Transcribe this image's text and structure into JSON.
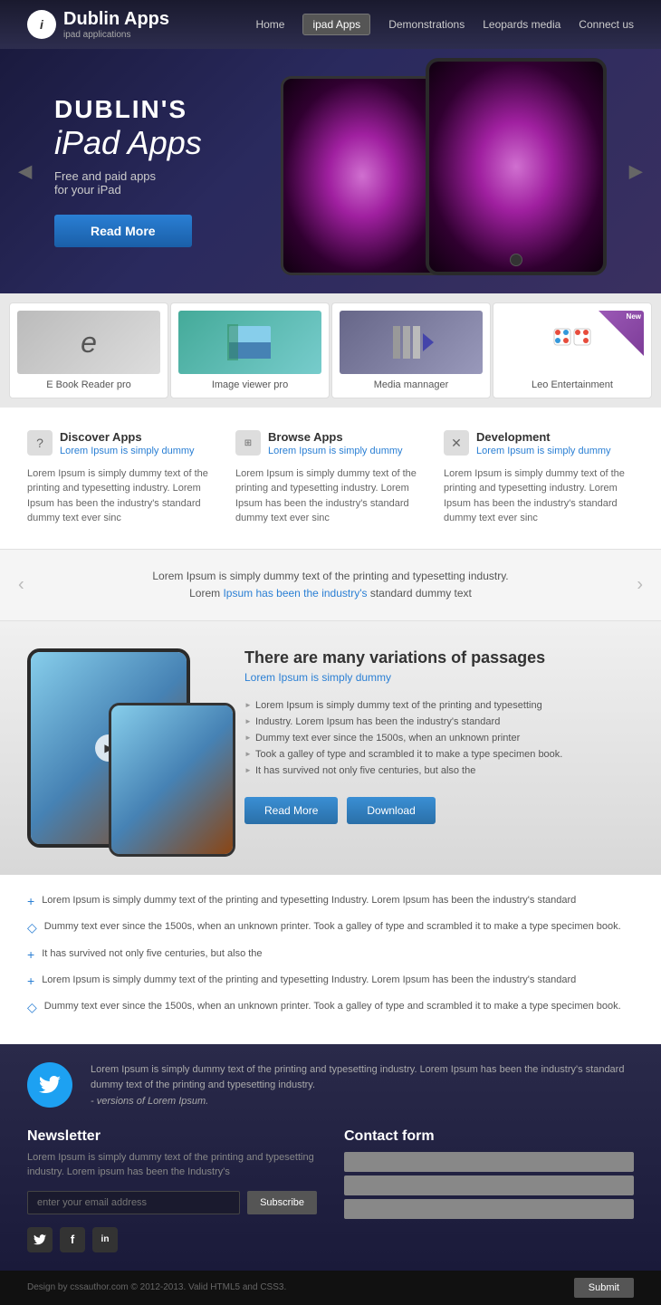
{
  "header": {
    "logo_icon": "i",
    "logo_name": "Dublin Apps",
    "logo_sub": "ipad applications",
    "nav": [
      {
        "label": "Home",
        "active": false
      },
      {
        "label": "ipad Apps",
        "active": true
      },
      {
        "label": "Demonstrations",
        "active": false
      },
      {
        "label": "Leopards media",
        "active": false
      },
      {
        "label": "Connect us",
        "active": false
      }
    ]
  },
  "hero": {
    "line1": "DUBLIN'S",
    "line2": "iPad Apps",
    "desc": "Free and paid apps\nfor your iPad",
    "cta": "Read More"
  },
  "apps": [
    {
      "name": "E Book Reader pro",
      "type": "ebook"
    },
    {
      "name": "Image viewer pro",
      "type": "imageviewer"
    },
    {
      "name": "Media mannager",
      "type": "media"
    },
    {
      "name": "Leo Entertainment",
      "type": "leo",
      "new": true
    }
  ],
  "features": [
    {
      "icon": "?",
      "title": "Discover Apps",
      "sub": "Lorem Ipsum is simply dummy",
      "body": "Lorem Ipsum is simply dummy text of the printing and typesetting industry. Lorem Ipsum has been the industry's standard dummy text ever sinc"
    },
    {
      "icon": "⊞",
      "title": "Browse Apps",
      "sub": "Lorem Ipsum is simply dummy",
      "body": "Lorem Ipsum is simply dummy text of the printing and typesetting industry. Lorem Ipsum has been the industry's standard dummy text ever sinc"
    },
    {
      "icon": "✕",
      "title": "Development",
      "sub": "Lorem Ipsum is simply dummy",
      "body": "Lorem Ipsum is simply dummy text of the printing and typesetting industry. Lorem Ipsum has been the industry's standard dummy text ever sinc"
    }
  ],
  "testimonial": {
    "line1": "Lorem Ipsum is simply dummy text of the printing and typesetting industry.",
    "line2": "Lorem Ipsum has been the industry's standard dummy text"
  },
  "showcase": {
    "title": "There are many variations of passages",
    "sub": "Lorem Ipsum is simply dummy",
    "items": [
      "Lorem Ipsum is simply dummy text of the printing and typesetting",
      "Industry. Lorem Ipsum has been the industry's standard",
      "Dummy text ever since the 1500s, when an unknown printer",
      "Took a galley of type and scrambled it to make a type specimen book.",
      "It has survived not only five centuries, but also the"
    ],
    "btn_read": "Read More",
    "btn_dl": "Download"
  },
  "bullets": [
    "Lorem Ipsum is simply dummy text of the printing and typesetting Industry. Lorem Ipsum has been the industry's standard",
    "Dummy text ever since the 1500s, when an unknown printer. Took a galley of type and scrambled it to make a type specimen book.",
    "It has survived not only five centuries, but also the",
    "Lorem Ipsum is simply dummy text of the printing and typesetting Industry. Lorem Ipsum has been the industry's standard",
    "Dummy text ever since the 1500s, when an unknown printer. Took a galley of type and scrambled it to make a type specimen book."
  ],
  "footer": {
    "twitter_text": "Lorem Ipsum is simply dummy text of the printing and typesetting industry. Lorem Ipsum has been the industry's standard dummy text  of the printing and typesetting industry.",
    "twitter_credit": "- versions of Lorem Ipsum.",
    "newsletter": {
      "title": "Newsletter",
      "body": "Lorem Ipsum is simply dummy text of the printing and typesetting industry. Lorem ipsum has been the Industry's",
      "placeholder": "enter your email address",
      "btn": "Subscribe"
    },
    "contact": {
      "title": "Contact form",
      "fields": [
        "",
        "",
        ""
      ]
    },
    "social": [
      "𝕏",
      "f",
      "in"
    ],
    "copyright": "Design by cssauthor.com © 2012-2013. Valid HTML5 and CSS3.",
    "submit": "Submit"
  }
}
